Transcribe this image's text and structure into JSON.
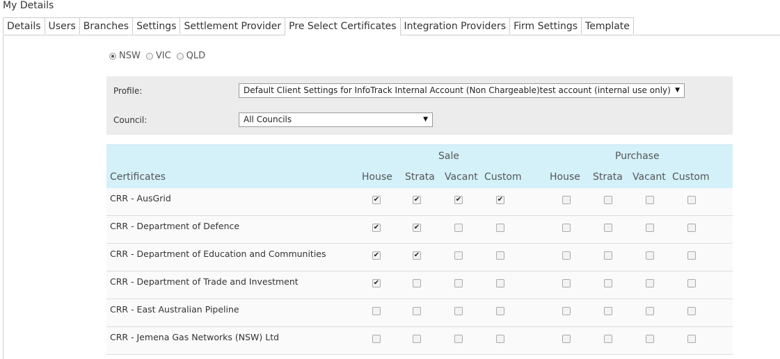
{
  "page": {
    "title": "My Details"
  },
  "tabs": [
    {
      "label": "Details",
      "active": false
    },
    {
      "label": "Users",
      "active": false
    },
    {
      "label": "Branches",
      "active": false
    },
    {
      "label": "Settings",
      "active": false
    },
    {
      "label": "Settlement Provider",
      "active": false
    },
    {
      "label": "Pre Select Certificates",
      "active": true
    },
    {
      "label": "Integration Providers",
      "active": false
    },
    {
      "label": "Firm Settings",
      "active": false
    },
    {
      "label": "Template",
      "active": false
    }
  ],
  "states": [
    {
      "label": "NSW",
      "selected": true
    },
    {
      "label": "VIC",
      "selected": false
    },
    {
      "label": "QLD",
      "selected": false
    }
  ],
  "filters": {
    "profile_label": "Profile:",
    "profile_value": "Default Client Settings for InfoTrack Internal Account (Non Chargeable)test account (internal use only)",
    "council_label": "Council:",
    "council_value": "All Councils"
  },
  "grid": {
    "certificates_header": "Certificates",
    "groups": [
      "Sale",
      "Purchase"
    ],
    "columns": [
      "House",
      "Strata",
      "Vacant",
      "Custom",
      "House",
      "Strata",
      "Vacant",
      "Custom"
    ],
    "rows": [
      {
        "name": "CRR - AusGrid",
        "checks": [
          true,
          true,
          true,
          true,
          false,
          false,
          false,
          false
        ]
      },
      {
        "name": "CRR - Department of Defence",
        "checks": [
          true,
          true,
          false,
          false,
          false,
          false,
          false,
          false
        ]
      },
      {
        "name": "CRR - Department of Education and Communities",
        "checks": [
          true,
          true,
          false,
          false,
          false,
          false,
          false,
          false
        ]
      },
      {
        "name": "CRR - Department of Trade and Investment",
        "checks": [
          true,
          false,
          false,
          false,
          false,
          false,
          false,
          false
        ]
      },
      {
        "name": "CRR - East Australian Pipeline",
        "checks": [
          false,
          false,
          false,
          false,
          false,
          false,
          false,
          false
        ]
      },
      {
        "name": "CRR - Jemena Gas Networks (NSW) Ltd",
        "checks": [
          false,
          false,
          false,
          false,
          false,
          false,
          false,
          false
        ]
      }
    ]
  },
  "icons": {
    "select_caret": "▼",
    "check": "✔"
  }
}
